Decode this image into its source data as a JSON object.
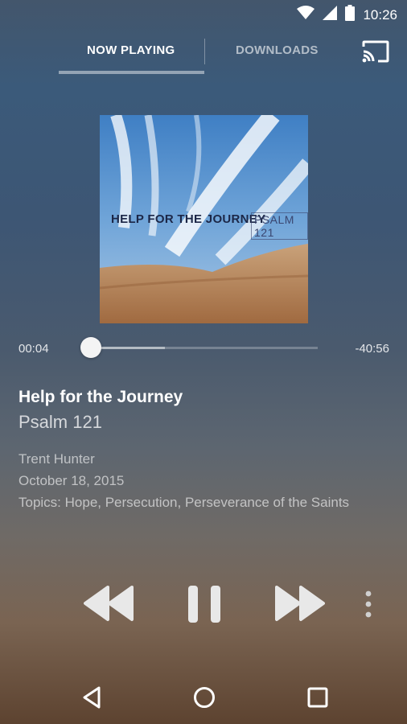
{
  "status_bar": {
    "time": "10:26"
  },
  "tabs": [
    {
      "label": "NOW PLAYING",
      "active": true
    },
    {
      "label": "DOWNLOADS",
      "active": false
    }
  ],
  "artwork": {
    "title_text": "HELP FOR THE JOURNEY",
    "subtitle_text": "PSALM 121"
  },
  "player": {
    "elapsed": "00:04",
    "remaining": "-40:56",
    "progress_fraction": 0.002,
    "buffered_fraction": 0.33
  },
  "sermon": {
    "title": "Help for the Journey",
    "scripture": "Psalm 121",
    "speaker": "Trent Hunter",
    "date": "October 18, 2015",
    "topics": "Topics: Hope, Persecution, Perseverance of the Saints"
  },
  "colors": {
    "bg_top": "#3b5a7a",
    "bg_bottom": "#5d4330",
    "tab_indicator": "#a0a8b4",
    "control_icon": "#e8e8e8"
  },
  "icons": {
    "wifi": "wifi-icon",
    "signal": "signal-icon",
    "battery": "battery-icon",
    "cast": "cast-icon",
    "rewind": "rewind-icon",
    "pause": "pause-icon",
    "fast_forward": "fast-forward-icon",
    "more": "more-vert-icon",
    "back": "back-icon",
    "home": "home-icon",
    "recents": "recents-icon"
  }
}
